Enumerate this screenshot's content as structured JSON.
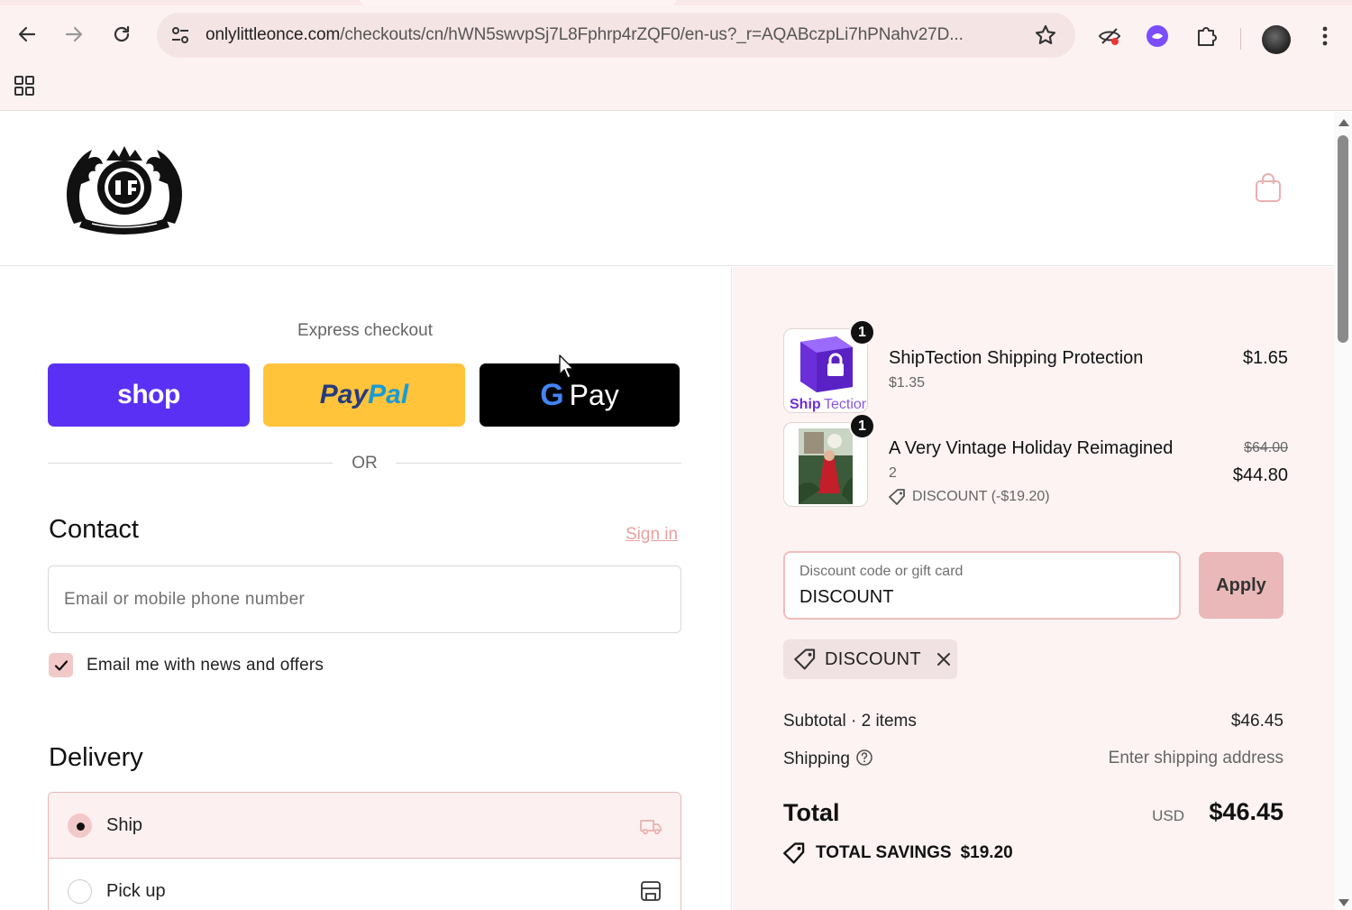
{
  "browser": {
    "url_host": "onlylittleonce.com",
    "url_path": "/checkouts/cn/hWN5swvpSj7L8Fphrp4rZQF0/en-us?_r=AQABczpLi7hPNahv27D..."
  },
  "header": {
    "logo": "store-crest-logo",
    "cart_icon": "shopping-bag-icon"
  },
  "express": {
    "label": "Express checkout",
    "shop_label": "shop",
    "paypal_label_1": "Pay",
    "paypal_label_2": "Pal",
    "gpay_g": "G",
    "gpay_label": "Pay",
    "or_label": "OR"
  },
  "contact": {
    "title": "Contact",
    "signin": "Sign in",
    "email_placeholder": "Email or mobile phone number",
    "newsletter_label": "Email me with news and offers",
    "newsletter_checked": true
  },
  "delivery": {
    "title": "Delivery",
    "options": [
      {
        "label": "Ship",
        "selected": true,
        "icon": "truck-icon"
      },
      {
        "label": "Pick up",
        "selected": false,
        "icon": "store-icon"
      }
    ]
  },
  "order": {
    "items": [
      {
        "name": "ShipTection Shipping Protection",
        "sub": "$1.35",
        "price": "$1.65",
        "qty": "1",
        "thumb_text_1": "Ship",
        "thumb_text_2": "Tectior"
      },
      {
        "name": "A Very Vintage Holiday Reimagined",
        "sub": "2",
        "original_price": "$64.00",
        "price": "$44.80",
        "qty": "1",
        "discount": "DISCOUNT (-$19.20)"
      }
    ],
    "discount_field": {
      "label": "Discount code or gift card",
      "value": "DISCOUNT"
    },
    "apply_label": "Apply",
    "applied_code": "DISCOUNT",
    "subtotal_label": "Subtotal · 2 items",
    "subtotal_value": "$46.45",
    "shipping_label": "Shipping",
    "shipping_value": "Enter shipping address",
    "total_label": "Total",
    "total_currency": "USD",
    "total_value": "$46.45",
    "savings_label": "TOTAL SAVINGS",
    "savings_value": "$19.20"
  },
  "colors": {
    "shop": "#5a31f4",
    "paypal": "#ffc43a",
    "gpay": "#000000",
    "accent_pink": "#eab8b8",
    "summary_bg": "#fdf3f3"
  }
}
